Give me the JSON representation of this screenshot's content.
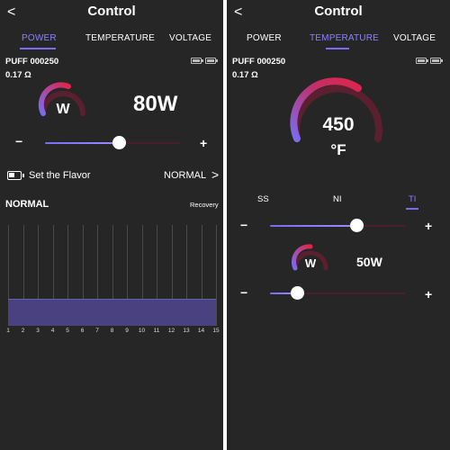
{
  "left": {
    "back": "<",
    "title": "Control",
    "tabs": [
      "POWER",
      "TEMPERATURE",
      "VOLTAGE"
    ],
    "device_name": "PUFF  000250",
    "resistance": "0.17 Ω",
    "gauge_unit": "W",
    "power_value": "80W",
    "power_level": 0.55,
    "minus": "−",
    "plus": "+",
    "flavor_label": "Set the Flavor",
    "flavor_value": "NORMAL",
    "chevron": ">",
    "curve_title": "NORMAL",
    "curve_action": "Recovery"
  },
  "right": {
    "back": "<",
    "title": "Control",
    "tabs": [
      "POWER",
      "TEMPERATURE",
      "VOLTAGE"
    ],
    "device_name": "PUFF  000250",
    "resistance": "0.17 Ω",
    "temp_value": "450",
    "temp_unit": "°F",
    "materials": [
      "SS",
      "NI",
      "TI"
    ],
    "minus": "−",
    "plus": "+",
    "temp_level": 0.64,
    "gauge_unit": "W",
    "power_value": "50W",
    "power_level": 0.2
  },
  "chart_data": {
    "type": "bar",
    "categories": [
      "1",
      "2",
      "3",
      "4",
      "5",
      "6",
      "7",
      "8",
      "9",
      "10",
      "11",
      "12",
      "13",
      "14",
      "15"
    ],
    "values": [
      0.27,
      0.27,
      0.27,
      0.27,
      0.27,
      0.27,
      0.27,
      0.27,
      0.27,
      0.27,
      0.27,
      0.27,
      0.27,
      0.27,
      0.27
    ],
    "ylim": [
      0,
      1
    ],
    "grid": true
  },
  "colors": {
    "background": "#262626",
    "accent": "#8f80ff",
    "gauge_red": "#e0254a",
    "gauge_purple": "#7a6cf0",
    "bar_fill": "#4a4280"
  }
}
